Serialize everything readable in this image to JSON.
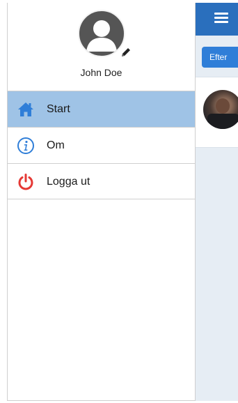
{
  "user": {
    "name": "John Doe",
    "avatar_icon": "user-silhouette-icon",
    "edit_icon": "pencil-icon"
  },
  "menu": {
    "items": [
      {
        "label": "Start",
        "icon": "home-icon",
        "active": true,
        "icon_color": "#2f7ed8"
      },
      {
        "label": "Om",
        "icon": "info-icon",
        "active": false,
        "icon_color": "#2f7ed8"
      },
      {
        "label": "Logga ut",
        "icon": "power-icon",
        "active": false,
        "icon_color": "#e53935"
      }
    ]
  },
  "background_app": {
    "menu_icon": "hamburger-icon",
    "filter_button_label": "Efter"
  },
  "colors": {
    "header": "#2a6fbd",
    "active_item": "#9fc3e6",
    "accent": "#2f7ed8",
    "logout": "#e53935"
  }
}
